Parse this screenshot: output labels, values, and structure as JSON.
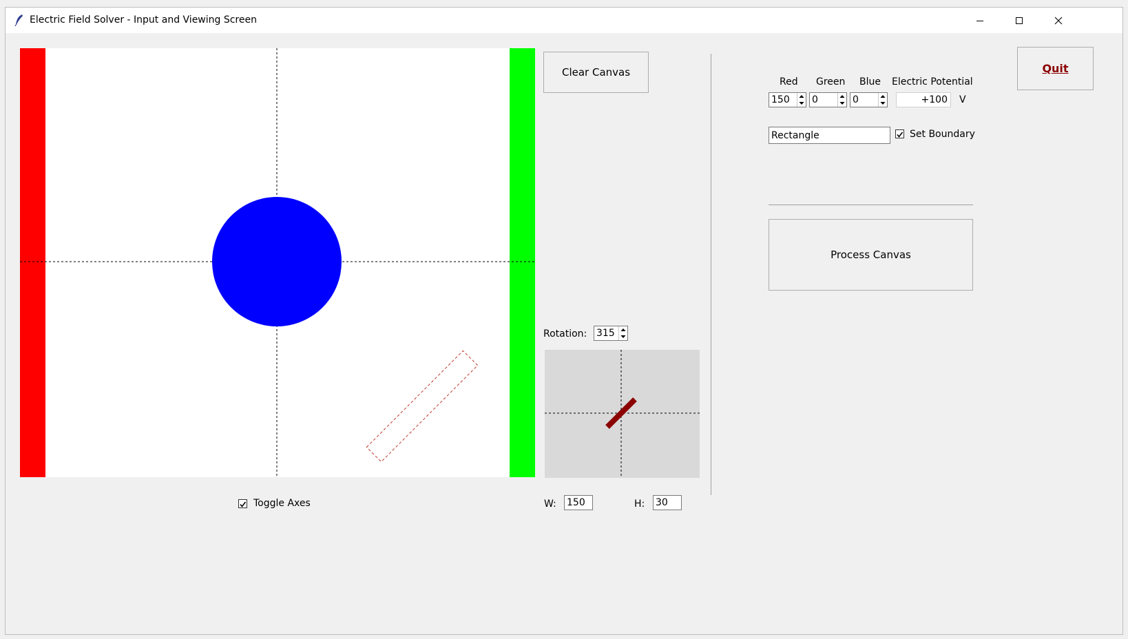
{
  "window": {
    "title": "Electric Field Solver - Input and Viewing Screen",
    "controls": [
      "minimize-icon",
      "maximize-icon",
      "close-icon"
    ]
  },
  "canvas": {
    "shapes": [
      {
        "type": "rectangle",
        "fill": "#ff0000",
        "role": "left-boundary"
      },
      {
        "type": "rectangle",
        "fill": "#00ff00",
        "role": "right-boundary"
      },
      {
        "type": "circle",
        "fill": "#0000ff"
      },
      {
        "type": "rectangle-outline",
        "stroke": "#c0392b",
        "style": "dashed",
        "rotation": 315
      }
    ],
    "axes_visible": true,
    "toggle_axes_label": "Toggle Axes",
    "toggle_axes_checked": true
  },
  "toolbar": {
    "clear_label": "Clear Canvas",
    "rotation_label": "Rotation:",
    "rotation_value": "315",
    "w_label": "W:",
    "w_value": "150",
    "h_label": "H:",
    "h_value": "30",
    "preview_color": "#8b0000"
  },
  "settings": {
    "red_label": "Red",
    "green_label": "Green",
    "blue_label": "Blue",
    "potential_label": "Electric Potential",
    "red_value": "150",
    "green_value": "0",
    "blue_value": "0",
    "potential_value": "+100",
    "potential_unit": "V",
    "shape_value": "Rectangle",
    "set_boundary_label": "Set Boundary",
    "set_boundary_checked": true,
    "process_label": "Process Canvas",
    "quit_label": "Quit",
    "quit_color": "#8b0000"
  }
}
